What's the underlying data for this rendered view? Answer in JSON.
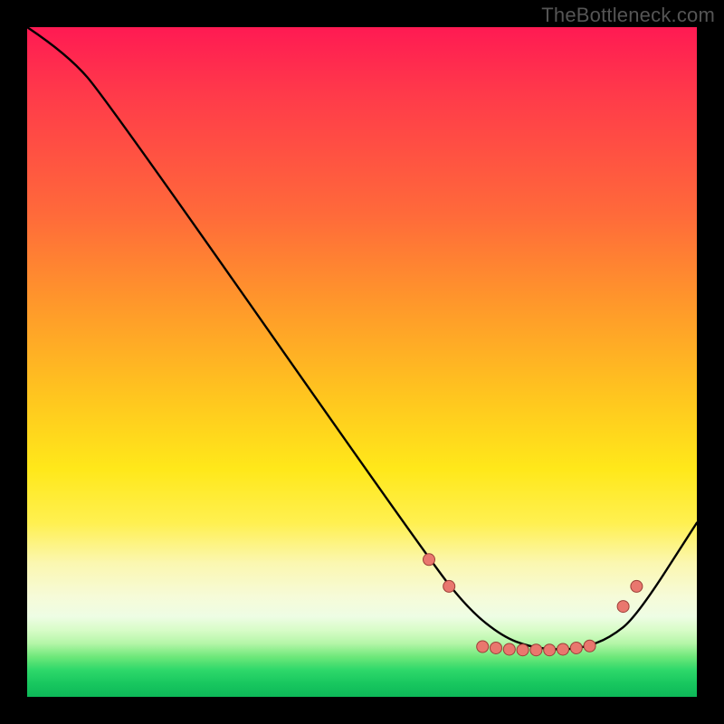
{
  "watermark": "TheBottleneck.com",
  "colors": {
    "curve_stroke": "#000000",
    "dot_fill": "#e9776e",
    "dot_stroke": "#9c3f38",
    "gradient_top": "#ff1a53",
    "gradient_bottom": "#0db858",
    "page_bg": "#000000"
  },
  "chart_data": {
    "type": "line",
    "title": "",
    "xlabel": "",
    "ylabel": "",
    "xlim": [
      0,
      100
    ],
    "ylim": [
      0,
      100
    ],
    "grid": false,
    "legend": false,
    "curve": [
      {
        "x": 0,
        "y": 100
      },
      {
        "x": 6,
        "y": 96
      },
      {
        "x": 12,
        "y": 89
      },
      {
        "x": 60,
        "y": 20.5
      },
      {
        "x": 66,
        "y": 13
      },
      {
        "x": 71,
        "y": 9
      },
      {
        "x": 75,
        "y": 7.5
      },
      {
        "x": 79,
        "y": 7
      },
      {
        "x": 83,
        "y": 7.3
      },
      {
        "x": 87,
        "y": 8.8
      },
      {
        "x": 91,
        "y": 12
      },
      {
        "x": 100,
        "y": 26
      }
    ],
    "dots": [
      {
        "x": 60,
        "y": 20.5
      },
      {
        "x": 63,
        "y": 16.5
      },
      {
        "x": 68,
        "y": 7.5
      },
      {
        "x": 70,
        "y": 7.3
      },
      {
        "x": 72,
        "y": 7.1
      },
      {
        "x": 74,
        "y": 7.0
      },
      {
        "x": 76,
        "y": 7.0
      },
      {
        "x": 78,
        "y": 7.0
      },
      {
        "x": 80,
        "y": 7.1
      },
      {
        "x": 82,
        "y": 7.3
      },
      {
        "x": 84,
        "y": 7.6
      },
      {
        "x": 89,
        "y": 13.5
      },
      {
        "x": 91,
        "y": 16.5
      }
    ]
  }
}
